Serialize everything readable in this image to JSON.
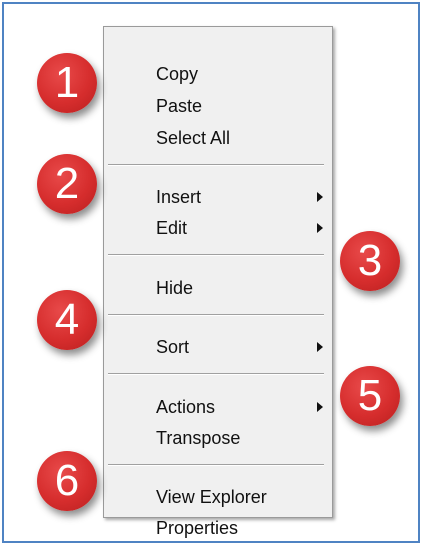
{
  "menu": {
    "items": [
      {
        "label": "Copy",
        "submenu": false
      },
      {
        "label": "Paste",
        "submenu": false
      },
      {
        "label": "Select All",
        "submenu": false
      },
      {
        "label": "Insert",
        "submenu": true
      },
      {
        "label": "Edit",
        "submenu": true
      },
      {
        "label": "Hide",
        "submenu": false
      },
      {
        "label": "Sort",
        "submenu": true
      },
      {
        "label": "Actions",
        "submenu": true
      },
      {
        "label": "Transpose",
        "submenu": false
      },
      {
        "label": "View Explorer",
        "submenu": false
      },
      {
        "label": "Properties",
        "submenu": false
      }
    ]
  },
  "badges": [
    "1",
    "2",
    "3",
    "4",
    "5",
    "6"
  ],
  "colors": {
    "frame_border": "#4f83c3",
    "menu_background": "#f0f0f0",
    "badge_red": "#d62d2d"
  },
  "icons": {
    "submenu_arrow": "submenu-arrow-icon"
  }
}
